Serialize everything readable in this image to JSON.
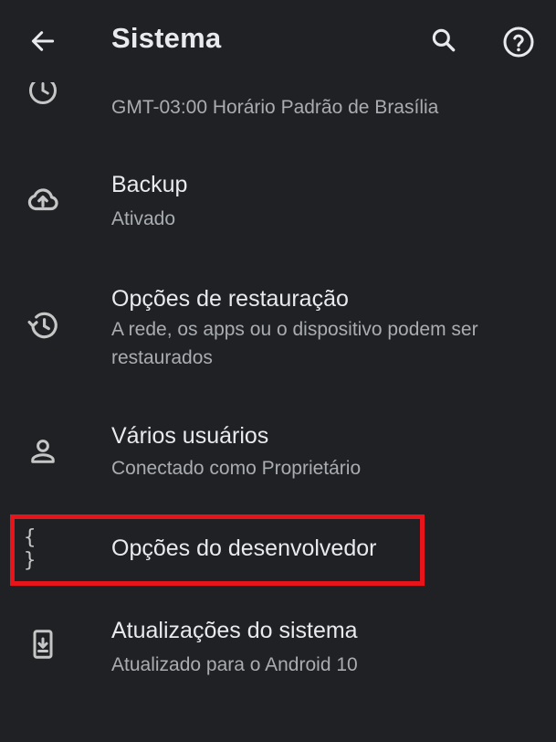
{
  "header": {
    "title": "Sistema",
    "back_icon": "arrow-back-icon",
    "search_icon": "search-icon",
    "help_icon": "help-icon"
  },
  "items": [
    {
      "icon": "clock-icon",
      "primary": "",
      "secondary": "GMT-03:00 Horário Padrão de Brasília"
    },
    {
      "icon": "cloud-upload-icon",
      "primary": "Backup",
      "secondary": "Ativado"
    },
    {
      "icon": "restore-history-icon",
      "primary": "Opções de restauração",
      "secondary": "A rede, os apps ou o dispositivo podem ser restaurados"
    },
    {
      "icon": "person-icon",
      "primary": "Vários usuários",
      "secondary": "Conectado como Proprietário"
    },
    {
      "icon": "braces-icon",
      "icon_text": "{ }",
      "primary": "Opções do desenvolvedor",
      "secondary": ""
    },
    {
      "icon": "system-update-icon",
      "primary": "Atualizações do sistema",
      "secondary": "Atualizado para o Android 10"
    }
  ],
  "colors": {
    "background": "#202124",
    "text_primary": "#e8eaed",
    "text_secondary": "#a9acb0",
    "highlight": "#e8141b"
  }
}
